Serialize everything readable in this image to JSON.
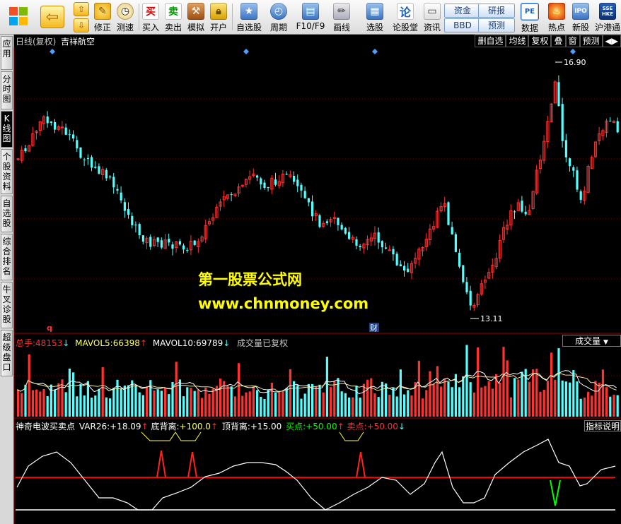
{
  "toolbar": {
    "items": [
      {
        "label": "",
        "icon": "windows-logo-icon"
      },
      {
        "label": "",
        "icon": "back-arrow-icon"
      },
      {
        "label": "修正",
        "icon": "modify-icon"
      },
      {
        "label": "测速",
        "icon": "speed-test-icon"
      },
      {
        "label": "买入",
        "icon": "buy-icon",
        "icon_text": "买"
      },
      {
        "label": "卖出",
        "icon": "sell-icon",
        "icon_text": "卖"
      },
      {
        "label": "模拟",
        "icon": "hammer-icon"
      },
      {
        "label": "开户",
        "icon": "lock-icon"
      },
      {
        "label": "自选股",
        "icon": "star-icon"
      },
      {
        "label": "周期",
        "icon": "clock-icon"
      },
      {
        "label": "F10/F9",
        "icon": "f10-icon"
      },
      {
        "label": "画线",
        "icon": "pencil-icon"
      },
      {
        "label": "选股",
        "icon": "select-stock-icon"
      },
      {
        "label": "论股堂",
        "icon": "discuss-icon",
        "icon_text": "论"
      },
      {
        "label": "资讯",
        "icon": "news-icon"
      },
      {
        "label": "数据",
        "icon": "pe-icon",
        "icon_text": "PE"
      },
      {
        "label": "热点",
        "icon": "hot-icon"
      },
      {
        "label": "新股",
        "icon": "ipo-icon",
        "icon_text": "IPO"
      },
      {
        "label": "沪港通",
        "icon": "sse-hke-icon",
        "icon_text": "SSE HKE"
      }
    ],
    "pills": [
      "资金",
      "BBD",
      "研报",
      "预测"
    ]
  },
  "sidebar": {
    "items": [
      "应用",
      "分时图",
      "K线图",
      "个股资料",
      "自选股",
      "综合排名",
      "牛叉诊股",
      "超级盘口"
    ]
  },
  "main": {
    "title_period": "日线(复权)",
    "title_stock": "吉祥航空",
    "right_buttons": [
      "删自选",
      "均线",
      "复权",
      "叠",
      "窗",
      "预测"
    ],
    "high_label": "16.90",
    "low_label": "13.11",
    "marker_q": "q",
    "marker_cai": "财"
  },
  "watermark": {
    "line1": "第一股票公式网",
    "line2": "www.chnmoney.com"
  },
  "volume": {
    "zongshou_label": "总手:",
    "zongshou_value": "48153",
    "mavol5_label": "MAVOL5:",
    "mavol5_value": "66398",
    "mavol10_label": "MAVOL10:",
    "mavol10_value": "69789",
    "note": "成交量已复权",
    "dropdown": "成交量"
  },
  "indicator": {
    "name": "神奇电波买卖点",
    "var26_label": "VAR26:",
    "var26_value": "+18.09",
    "dibeili_label": "底背离:",
    "dibeili_value": "+100.0",
    "dingbeili_label": "顶背离:",
    "dingbeili_value": "+15.00",
    "mai_label": "买点:",
    "mai_value": "+50.00",
    "mai2_label": "卖点:",
    "mai2_value": "+50.00",
    "explain_button": "指标说明"
  },
  "colors": {
    "up": "#ff3232",
    "down": "#54ffff",
    "background": "#000000",
    "indicator_red_line": "#ff0000",
    "buy_green": "#00ff00",
    "watermark": "#ffff00"
  }
}
